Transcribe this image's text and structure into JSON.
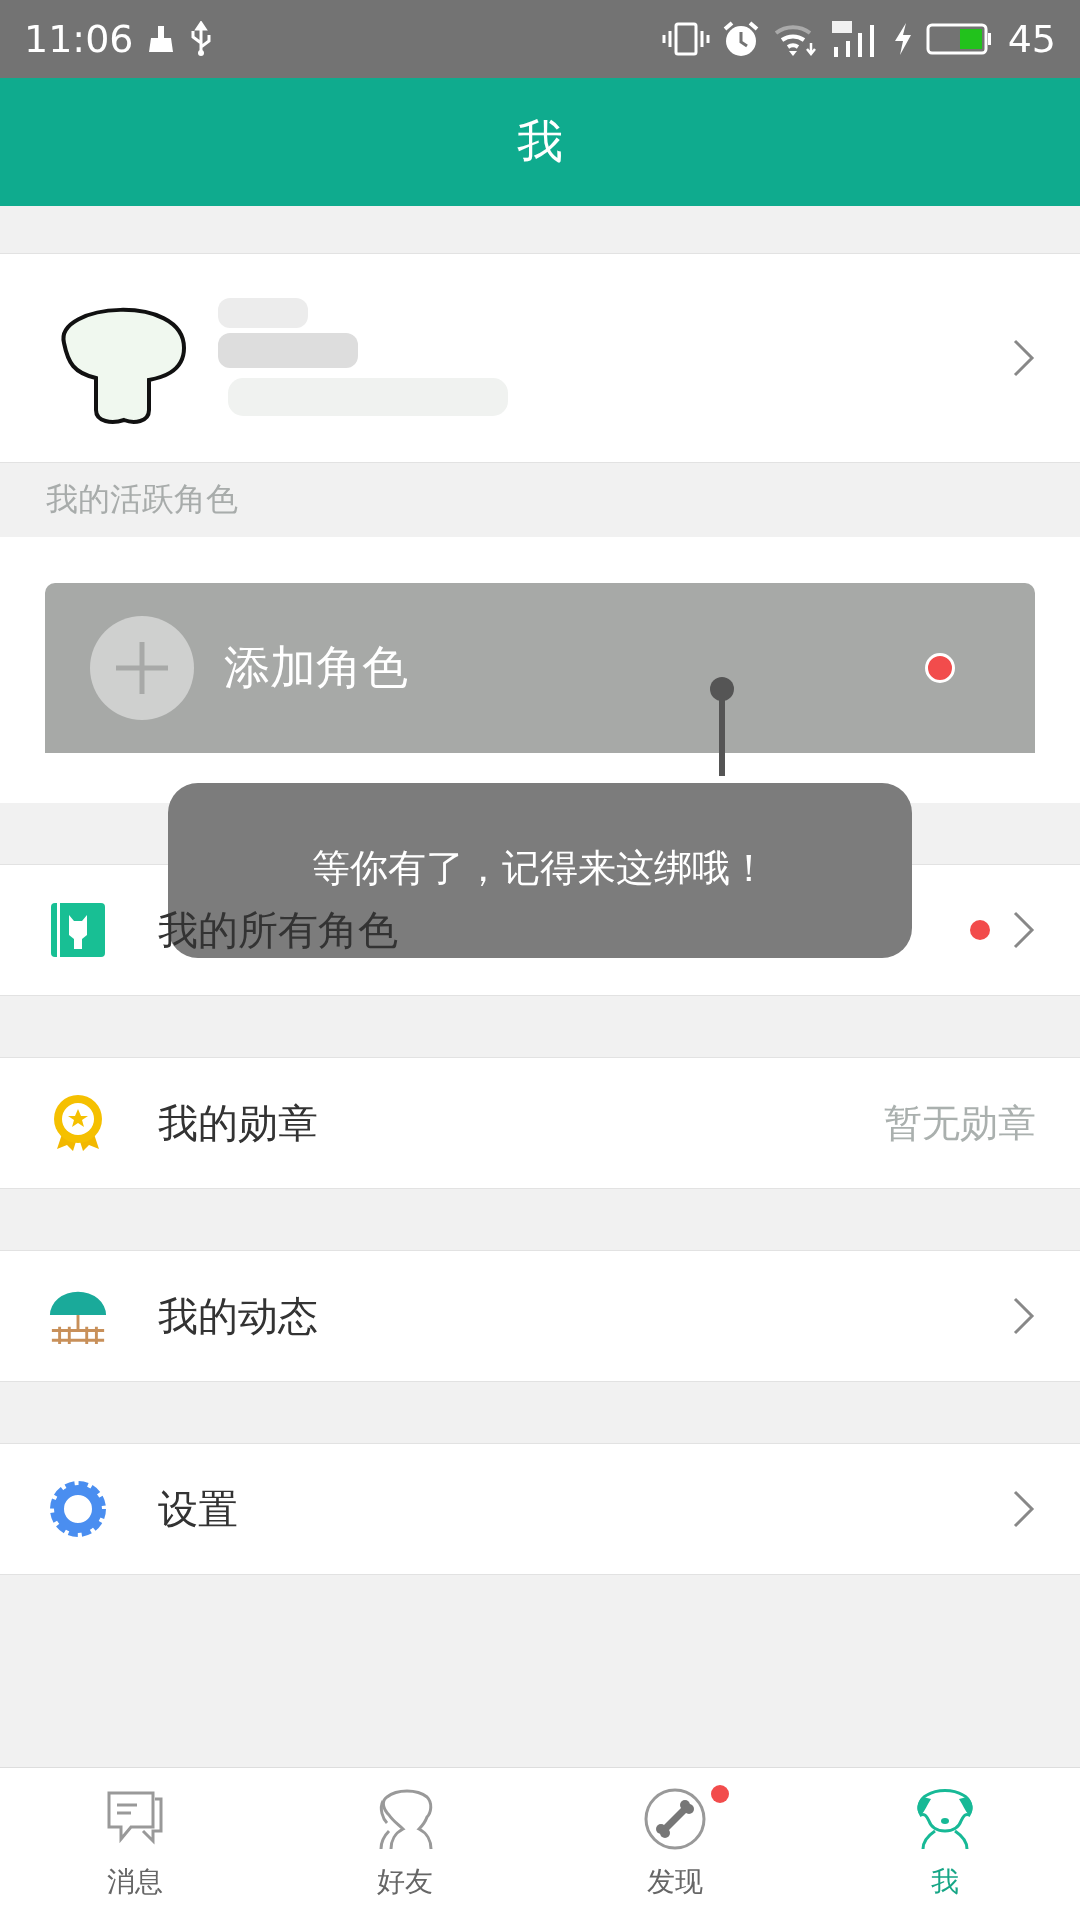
{
  "status_bar": {
    "time": "11:06",
    "battery": "45"
  },
  "header": {
    "title": "我"
  },
  "section_label": "我的活跃角色",
  "add_role": {
    "label": "添加角色",
    "badge": true
  },
  "tooltip": {
    "text": "等你有了，记得来这绑哦！"
  },
  "menu": [
    {
      "kind": "roles",
      "label": "我的所有角色",
      "badge": true,
      "chevron": true
    },
    {
      "kind": "medal",
      "label": "我的勋章",
      "value": "暂无勋章",
      "badge": false,
      "chevron": false
    },
    {
      "kind": "moments",
      "label": "我的动态",
      "badge": false,
      "chevron": true
    },
    {
      "kind": "settings",
      "label": "设置",
      "badge": false,
      "chevron": true
    }
  ],
  "tabs": [
    {
      "kind": "chat",
      "label": "消息",
      "selected": false,
      "badge": false
    },
    {
      "kind": "friends",
      "label": "好友",
      "selected": false,
      "badge": false
    },
    {
      "kind": "discover",
      "label": "发现",
      "selected": false,
      "badge": true
    },
    {
      "kind": "me",
      "label": "我",
      "selected": true,
      "badge": false
    }
  ]
}
